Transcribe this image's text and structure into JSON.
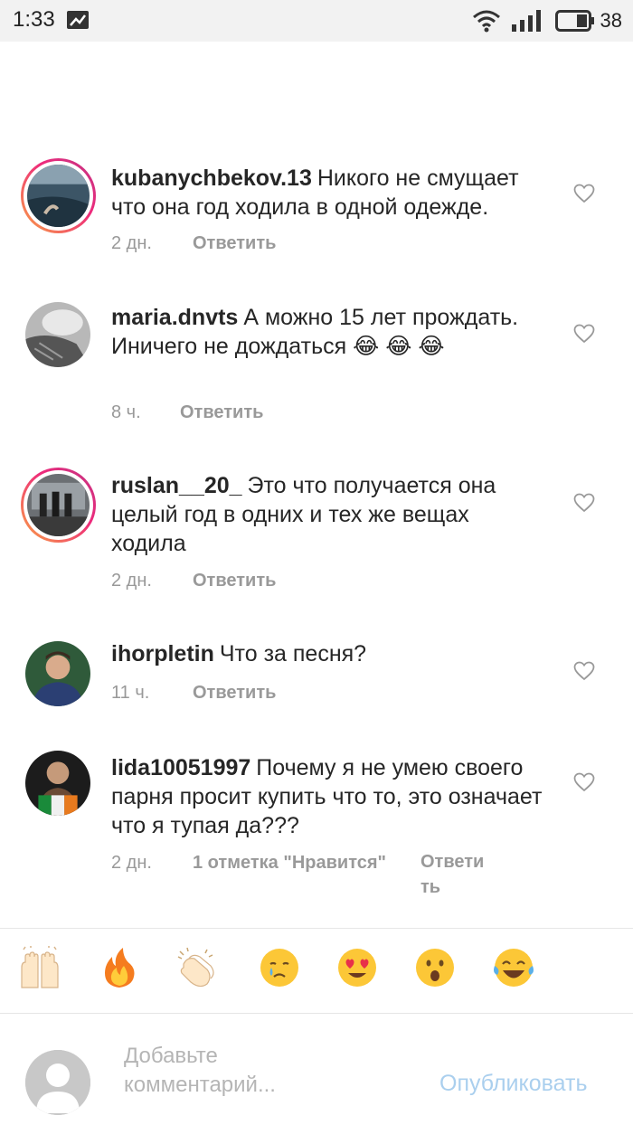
{
  "status_bar": {
    "time": "1:33",
    "battery": "38",
    "icons": [
      "notification-icon",
      "wifi-icon",
      "signal-icon",
      "battery-icon"
    ]
  },
  "comments": [
    {
      "username": "kubanychbekov.13",
      "text": "Никого не смущает что она год ходила в одной одежде.",
      "time": "2 дн.",
      "reply": "Ответить",
      "story_ring": true
    },
    {
      "username": "maria.dnvts",
      "text": "А можно 15 лет прождать. Иничего не дождаться 😂 😂 😂",
      "time": "8 ч.",
      "reply": "Ответить",
      "story_ring": false
    },
    {
      "username": "ruslan__20_",
      "text": "Это что получается она целый год в одних и тех же вещах ходила",
      "time": "2 дн.",
      "reply": "Ответить",
      "story_ring": true
    },
    {
      "username": "ihorpletin",
      "text": "Что за песня?",
      "time": "11 ч.",
      "reply": "Ответить",
      "story_ring": false
    },
    {
      "username": "lida10051997",
      "text": "Почему я не умею своего парня просит купить что то, это означает что я тупая да???",
      "time": "2 дн.",
      "likes": "1 отметка \"Нравится\"",
      "reply_line1": "Ответи",
      "reply_line2": "ть",
      "story_ring": false
    }
  ],
  "emoji_bar": {
    "items": [
      "🙌",
      "🔥",
      "👏",
      "😢",
      "😍",
      "😮",
      "😂"
    ]
  },
  "compose": {
    "placeholder_line1": "Добавьте",
    "placeholder_line2": "комментарий...",
    "publish_label": "Опубликовать"
  },
  "colors": {
    "accent_disabled": "#aacfee",
    "story_ring_start": "#f9a245",
    "story_ring_end": "#c13584"
  }
}
